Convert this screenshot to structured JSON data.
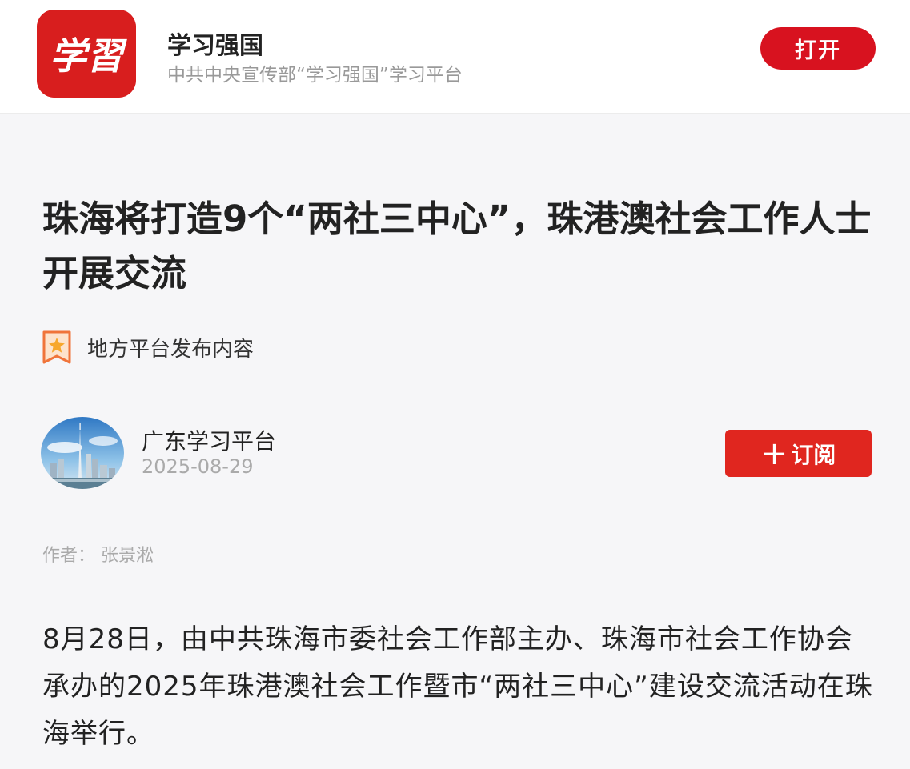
{
  "banner": {
    "logo_text": "学習",
    "app_name": "学习强国",
    "app_description": "中共中央宣传部“学习强国”学习平台",
    "open_button": "打开",
    "brand_color": "#d8121f"
  },
  "article": {
    "title": "珠海将打造9个“两社三中心”，珠港澳社会工作人士开展交流",
    "source_icon": "star-badge-icon",
    "source_label": "地方平台发布内容",
    "publisher": {
      "name": "广东学习平台",
      "date": "2025-08-29",
      "avatar": "city-skyline-avatar"
    },
    "subscribe_button": "订阅",
    "subscribe_icon": "plus-icon",
    "byline": "作者：  张景淞",
    "body": "8月28日，由中共珠海市委社会工作部主办、珠海市社会工作协会承办的2025年珠港澳社会工作暨市“两社三中心”建设交流活动在珠海举行。"
  }
}
